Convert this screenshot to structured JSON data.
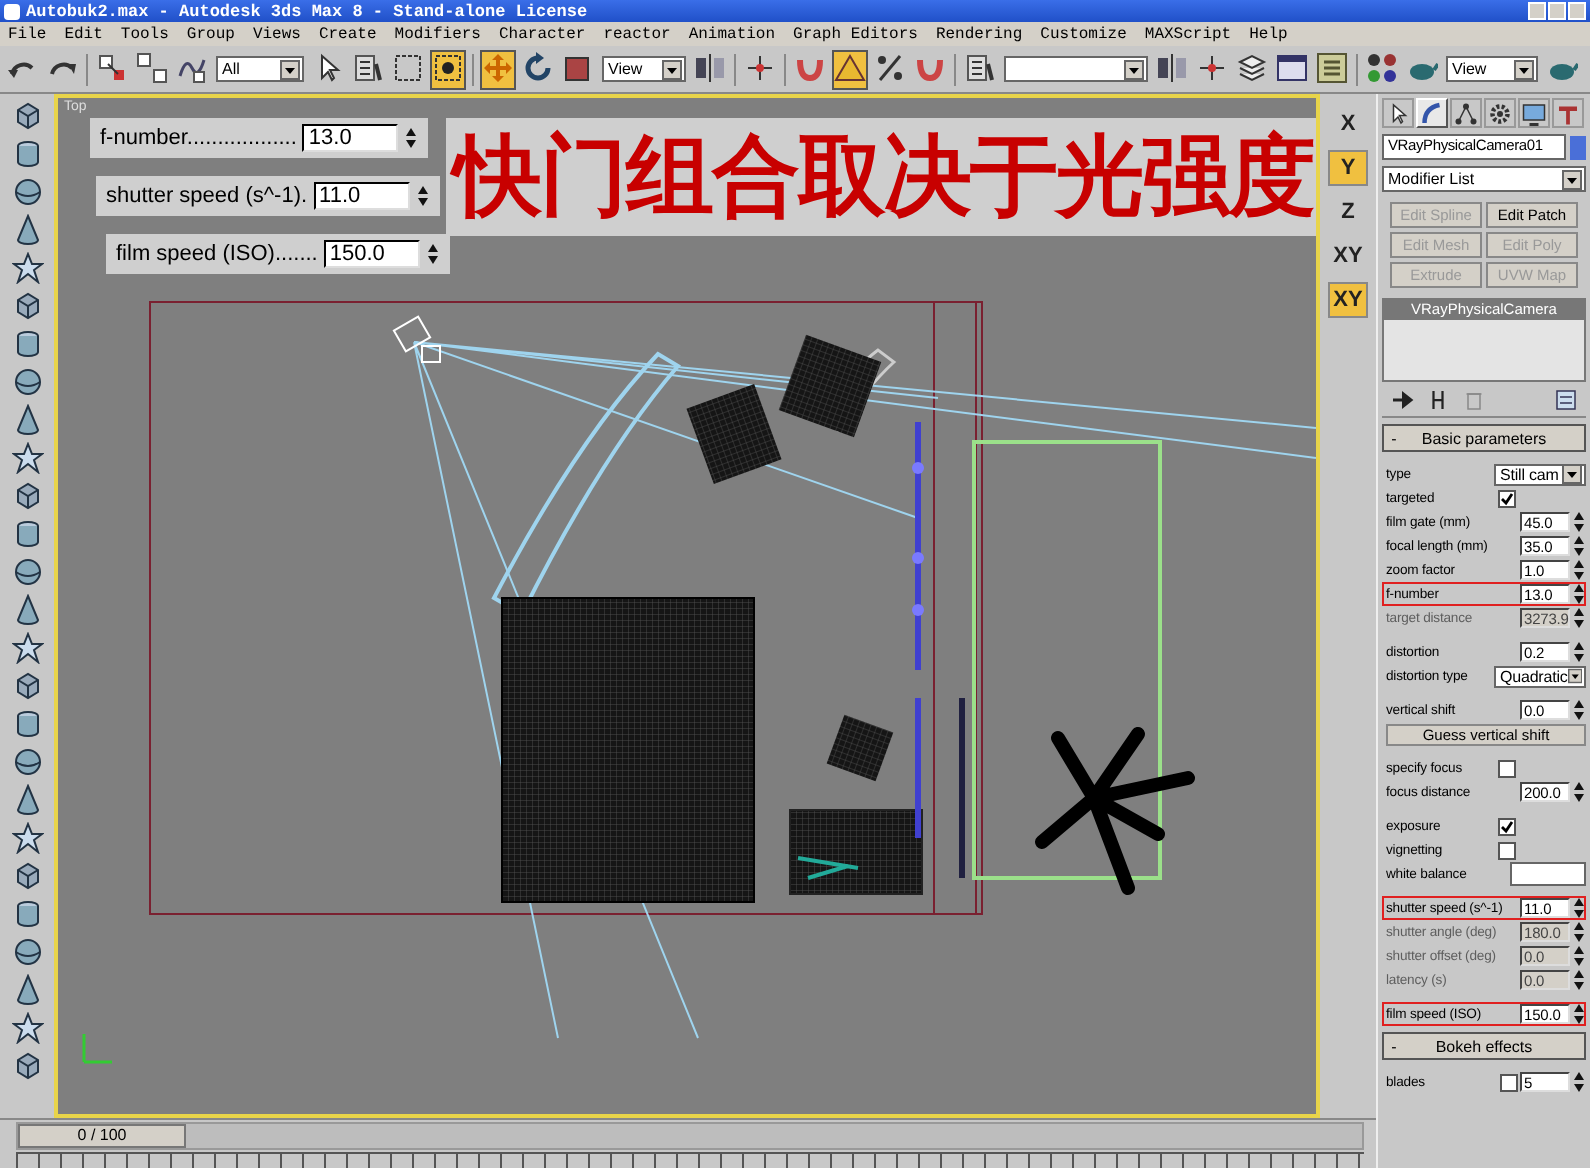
{
  "window": {
    "title": "Autobuk2.max - Autodesk 3ds Max 8  - Stand-alone License"
  },
  "menu": [
    "File",
    "Edit",
    "Tools",
    "Group",
    "Views",
    "Create",
    "Modifiers",
    "Character",
    "reactor",
    "Animation",
    "Graph Editors",
    "Rendering",
    "Customize",
    "MAXScript",
    "Help"
  ],
  "toolbar": {
    "selection_filter": "All",
    "reference_coordinate": "View",
    "render_view": "View"
  },
  "viewport": {
    "label": "Top",
    "caption": "快门组合取决于光强度",
    "overlay_fields": [
      {
        "label": "f-number..................",
        "value": "13.0"
      },
      {
        "label": "shutter speed (s^-1).",
        "value": "11.0"
      },
      {
        "label": "film speed (ISO).......",
        "value": "150.0"
      }
    ]
  },
  "axis_constraints": [
    {
      "label": "X",
      "selected": false
    },
    {
      "label": "Y",
      "selected": true
    },
    {
      "label": "Z",
      "selected": false
    },
    {
      "label": "XY",
      "selected": false
    },
    {
      "label": "XY",
      "selected": true
    }
  ],
  "command_panel": {
    "tabs": [
      {
        "selected": false
      },
      {
        "selected": true
      },
      {
        "selected": false
      },
      {
        "selected": false
      },
      {
        "selected": false
      },
      {
        "selected": false
      }
    ],
    "object_name": "VRayPhysicalCamera01",
    "modifier_list": "Modifier List",
    "modifier_buttons": [
      {
        "label": "Edit Spline",
        "disabled": true
      },
      {
        "label": "Edit Patch",
        "disabled": false
      },
      {
        "label": "Edit Mesh",
        "disabled": true
      },
      {
        "label": "Edit Poly",
        "disabled": true
      },
      {
        "label": "Extrude",
        "disabled": true
      },
      {
        "label": "UVW Map",
        "disabled": true
      }
    ],
    "stack": [
      {
        "label": "VRayPhysicalCamera",
        "selected": true
      }
    ],
    "rollouts": [
      {
        "sign": "-",
        "title": "Basic parameters",
        "groups": [
          [
            {
              "kind": "dropdown",
              "label": "type",
              "value": "Still cam"
            },
            {
              "kind": "check",
              "label": "targeted",
              "checked": true
            },
            {
              "kind": "spinner",
              "label": "film gate (mm)",
              "value": "45.0",
              "disabled": false,
              "highlighted": false
            },
            {
              "kind": "spinner",
              "label": "focal length (mm)",
              "value": "35.0",
              "disabled": false,
              "highlighted": false
            },
            {
              "kind": "spinner",
              "label": "zoom factor",
              "value": "1.0",
              "disabled": false,
              "highlighted": false
            },
            {
              "kind": "spinner",
              "label": "f-number",
              "value": "13.0",
              "disabled": false,
              "highlighted": true
            },
            {
              "kind": "spinner",
              "label": "target distance",
              "value": "3273.9",
              "disabled": true,
              "highlighted": false
            }
          ],
          [
            {
              "kind": "spinner",
              "label": "distortion",
              "value": "0.2",
              "disabled": false,
              "highlighted": false
            },
            {
              "kind": "dropdown",
              "label": "distortion type",
              "value": "Quadratic"
            }
          ],
          [
            {
              "kind": "spinner",
              "label": "vertical shift",
              "value": "0.0",
              "disabled": false,
              "highlighted": false
            },
            {
              "kind": "button",
              "label": "Guess vertical shift"
            }
          ],
          [
            {
              "kind": "check",
              "label": "specify focus",
              "checked": false
            },
            {
              "kind": "spinner",
              "label": "focus distance",
              "value": "200.0",
              "disabled": false,
              "highlighted": false
            }
          ],
          [
            {
              "kind": "check",
              "label": "exposure",
              "checked": true
            },
            {
              "kind": "check",
              "label": "vignetting",
              "checked": false
            },
            {
              "kind": "color",
              "label": "white balance",
              "color": "#ffffff"
            }
          ],
          [
            {
              "kind": "spinner",
              "label": "shutter speed (s^-1)",
              "value": "11.0",
              "disabled": false,
              "highlighted": true
            },
            {
              "kind": "spinner",
              "label": "shutter angle (deg)",
              "value": "180.0",
              "disabled": true,
              "highlighted": false
            },
            {
              "kind": "spinner",
              "label": "shutter offset (deg)",
              "value": "0.0",
              "disabled": true,
              "highlighted": false
            },
            {
              "kind": "spinner",
              "label": "latency (s)",
              "value": "0.0",
              "disabled": true,
              "highlighted": false
            }
          ],
          [
            {
              "kind": "spinner",
              "label": "film speed (ISO)",
              "value": "150.0",
              "disabled": false,
              "highlighted": true
            }
          ]
        ]
      },
      {
        "sign": "-",
        "title": "Bokeh effects",
        "groups": [
          [
            {
              "kind": "check_spinner",
              "label": "blades",
              "checked": false,
              "value": "5"
            }
          ]
        ]
      }
    ]
  },
  "timeline": {
    "position": "0 / 100",
    "level": 0
  }
}
